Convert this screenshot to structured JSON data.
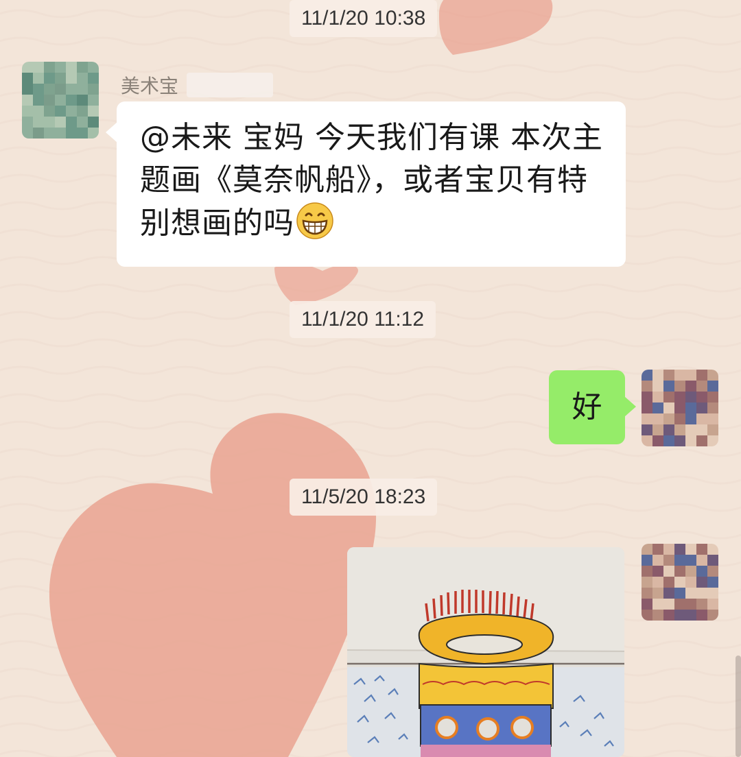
{
  "chat": {
    "background": {
      "base_color": "#f3e5d9",
      "decoration": "heart-doodles",
      "heart_color": "#e9a391"
    },
    "messages": [
      {
        "type": "timestamp",
        "text": "11/1/20 10:38"
      },
      {
        "type": "text",
        "direction": "incoming",
        "sender_name": "美术宝",
        "sender_name_obscured": true,
        "avatar": "blurred-avatar",
        "text": "@未来  宝妈 今天我们有课 本次主题画《莫奈帆船》，或者宝贝有特别想画的吗",
        "emoji": "grinning-face-emoji",
        "bubble_color": "#ffffff"
      },
      {
        "type": "timestamp",
        "text": "11/1/20 11:12"
      },
      {
        "type": "text",
        "direction": "outgoing",
        "avatar": "blurred-avatar",
        "text": "好",
        "bubble_color": "#95ec69"
      },
      {
        "type": "timestamp",
        "text": "11/5/20 18:23"
      },
      {
        "type": "image",
        "direction": "outgoing",
        "avatar": "blurred-avatar",
        "content": "child drawing of a ship with yellow hull, round portholes and many thin masts on blue sea"
      }
    ]
  }
}
